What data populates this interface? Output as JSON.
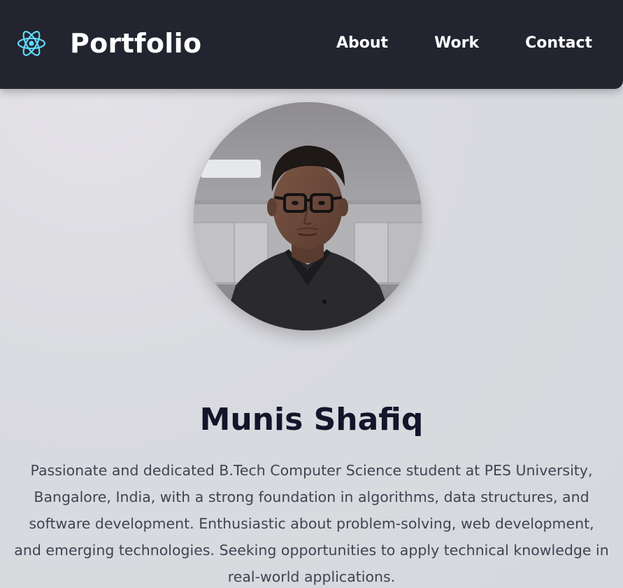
{
  "header": {
    "brand": "Portfolio",
    "logo_icon": "react-atom-icon",
    "nav": [
      {
        "label": "About"
      },
      {
        "label": "Work"
      },
      {
        "label": "Contact"
      }
    ]
  },
  "profile": {
    "avatar_icon": "profile-photo",
    "name": "Munis Shafiq",
    "bio": "Passionate and dedicated B.Tech Computer Science student at PES University, Bangalore, India, with a strong foundation in algorithms, data structures, and software development. Enthusiastic about problem-solving, web development, and emerging technologies. Seeking opportunities to apply technical knowledge in real-world applications."
  },
  "colors": {
    "navbar_bg": "#22242f",
    "logo_accent": "#61dafb",
    "name_text": "#13162a",
    "bio_text": "#3f4453",
    "page_bg": "#d9dbe0"
  }
}
